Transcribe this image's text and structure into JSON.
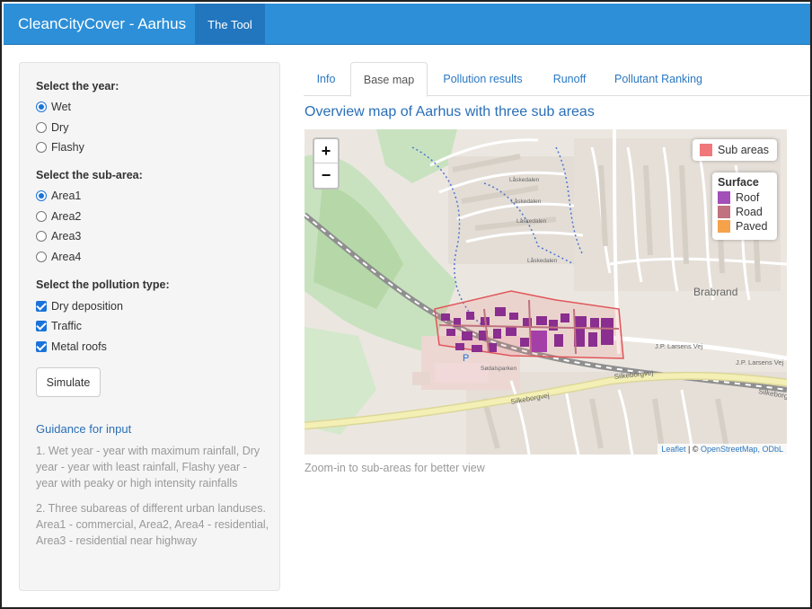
{
  "navbar": {
    "brand": "CleanCityCover - Aarhus",
    "tab": "The Tool"
  },
  "sidebar": {
    "year": {
      "label": "Select the year:",
      "options": [
        "Wet",
        "Dry",
        "Flashy"
      ],
      "selected": "Wet"
    },
    "subarea": {
      "label": "Select the sub-area:",
      "options": [
        "Area1",
        "Area2",
        "Area3",
        "Area4"
      ],
      "selected": "Area1"
    },
    "pollution": {
      "label": "Select the pollution type:",
      "options": [
        "Dry deposition",
        "Traffic",
        "Metal roofs"
      ],
      "checked": [
        "Dry deposition",
        "Traffic",
        "Metal roofs"
      ]
    },
    "simulate": "Simulate",
    "guidance": {
      "title": "Guidance for input",
      "p1": "1. Wet year - year with maximum rainfall, Dry year - year with least rainfall, Flashy year - year with peaky or high intensity rainfalls",
      "p2": "2. Three subareas of different urban landuses. Area1 - commercial, Area2, Area4 - residential, Area3 - residential near highway"
    }
  },
  "tabs": [
    "Info",
    "Base map",
    "Pollution results",
    "Runoff",
    "Pollutant Ranking"
  ],
  "active_tab": "Base map",
  "main": {
    "title": "Overview map of Aarhus with three sub areas",
    "caption": "Zoom-in to sub-areas for better view"
  },
  "map": {
    "zoom_in": "+",
    "zoom_out": "−",
    "legend_subareas": {
      "label": "Sub areas",
      "color": "#f0787a"
    },
    "legend_surface": {
      "title": "Surface",
      "items": [
        {
          "label": "Roof",
          "color": "#a24fb8"
        },
        {
          "label": "Road",
          "color": "#c0727e"
        },
        {
          "label": "Paved",
          "color": "#f5a24a"
        }
      ]
    },
    "attribution": {
      "leaflet": "Leaflet",
      "sep": " | © ",
      "osm": "OpenStreetMap, ODbL"
    },
    "labels": {
      "brabrand": "Brabrand",
      "silkeborgvej": "Silkeborgvej",
      "jp_larsens": "J.P. Larsens Vej",
      "laskedalen": "Låskedalen",
      "parking": "P",
      "sodalsparken": "Sødalsparken"
    }
  },
  "colors": {
    "navbar": "#2c8fd8",
    "link": "#2a78c2",
    "accent": "#1a73d9"
  }
}
